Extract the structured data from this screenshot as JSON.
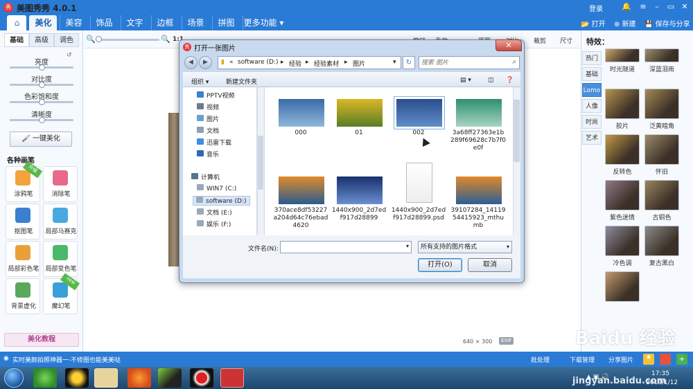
{
  "app": {
    "title": "美图秀秀 4.0.1",
    "logo": "秀",
    "login": "登录"
  },
  "nav": {
    "tabs": [
      "美化",
      "美容",
      "饰品",
      "文字",
      "边框",
      "场景",
      "拼图",
      "更多功能"
    ],
    "active": "美化",
    "actions": {
      "open": "打开",
      "new": "新建",
      "save_share": "保存与分享"
    }
  },
  "left": {
    "subtabs": [
      "基础",
      "高级",
      "调色"
    ],
    "sliders": [
      {
        "label": "亮度",
        "value": 0.5
      },
      {
        "label": "对比度",
        "value": 0.5
      },
      {
        "label": "色彩饱和度",
        "value": 0.5
      },
      {
        "label": "清晰度",
        "value": 0.5
      }
    ],
    "one_click": "一键美化",
    "brushes_heading": "各种画笔",
    "tools": [
      {
        "label": "涂鸦笔",
        "badge": "升级"
      },
      {
        "label": "消除笔",
        "badge": ""
      },
      {
        "label": "抠图笔",
        "badge": ""
      },
      {
        "label": "局部马赛克",
        "badge": ""
      },
      {
        "label": "局部彩色笔",
        "badge": ""
      },
      {
        "label": "局部变色笔",
        "badge": ""
      },
      {
        "label": "背景虚化",
        "badge": ""
      },
      {
        "label": "魔幻笔",
        "badge": "new"
      }
    ],
    "tutorial": "美化教程"
  },
  "toolbar": {
    "zoom_prefix": "1:1",
    "items": [
      "撤销",
      "重做",
      "原图",
      "对比",
      "裁剪",
      "尺寸"
    ]
  },
  "canvas": {
    "size": "640 × 300",
    "exif": "EXIF"
  },
  "right": {
    "title": "特效：",
    "categories": [
      "热门",
      "基础",
      "Lomo",
      "人像",
      "时尚",
      "艺术"
    ],
    "active_category": "Lomo",
    "effects": [
      {
        "label": "时光隧道",
        "color": "#c9a76d"
      },
      {
        "label": "深蓝泪雨",
        "color": "#9c8f6c"
      },
      {
        "label": "胶片",
        "color": "#b89550"
      },
      {
        "label": "泛黄暗角",
        "color": "#a48a55"
      },
      {
        "label": "反转色",
        "color": "#c29a48"
      },
      {
        "label": "怀旧",
        "color": "#9c8a6a"
      },
      {
        "label": "紫色迷情",
        "color": "#8f7a86"
      },
      {
        "label": "古铜色",
        "color": "#9a8461"
      },
      {
        "label": "冷色调",
        "color": "#8f8aa0"
      },
      {
        "label": "复古黑白",
        "color": "#8b8b8b"
      },
      {
        "label": "",
        "color": "#c39a6e"
      }
    ]
  },
  "bottom": {
    "tip": "实时美颜拍照神器一·不修图也能美美哒",
    "links": [
      "批处理",
      "下载管理",
      "分享图片"
    ]
  },
  "taskbar": {
    "time": "17:35",
    "date": "2019/1/12"
  },
  "watermark": {
    "logo": "Baidu 经验",
    "url": "jingyan.baidu.com"
  },
  "dialog": {
    "title": "打开一张图片",
    "close": "✕",
    "breadcrumb": [
      "«",
      "software (D:)",
      "▸",
      "经验",
      "▸",
      "经验素材",
      "▸",
      "图片"
    ],
    "search_placeholder": "搜索 图片",
    "commands": {
      "organize": "组织 ▾",
      "new_folder": "新建文件夹"
    },
    "nav_items": [
      {
        "label": "PPTV视频",
        "color": "#3a80d0"
      },
      {
        "label": "视频",
        "color": "#6a7b8f"
      },
      {
        "label": "图片",
        "color": "#6a9fd0"
      },
      {
        "label": "文档",
        "color": "#8fa0b4"
      },
      {
        "label": "迅雷下载",
        "color": "#3b8fe0"
      },
      {
        "label": "音乐",
        "color": "#2d6ab8"
      },
      {
        "label": "计算机",
        "color": "#5a7391"
      },
      {
        "label": "WIN7 (C:)",
        "color": "#9aa9b9"
      },
      {
        "label": "software (D:)",
        "color": "#9aa9b9"
      },
      {
        "label": "文档 (E:)",
        "color": "#9aa9b9"
      },
      {
        "label": "娱乐 (F:)",
        "color": "#9aa9b9"
      }
    ],
    "selected_nav": "software (D:)",
    "files": [
      {
        "name": "000",
        "colors": [
          "#3a6aa8",
          "#8fb7d9"
        ]
      },
      {
        "name": "01",
        "colors": [
          "#d9b824",
          "#5a7d28"
        ]
      },
      {
        "name": "002",
        "colors": [
          "#2b4c8c",
          "#5f8fc9"
        ]
      },
      {
        "name": "3a68ff27363e1b289f69628c7b7f0e0f",
        "colors": [
          "#2e8f6e",
          "#a8d4c2"
        ]
      },
      {
        "name": "370ace8df53227a204d64c76ebad4620",
        "colors": [
          "#e08a2a",
          "#2a5c8f"
        ]
      },
      {
        "name": "1440x900_2d7edf917d28899",
        "colors": [
          "#18306e",
          "#6a8fd0"
        ]
      },
      {
        "name": "1440x900_2d7edf917d28899.psd",
        "colors": [
          "#ffffff",
          "#eeeeee"
        ]
      },
      {
        "name": "39107284_1411954415923_mthumb",
        "colors": [
          "#e0892a",
          "#2b5f94"
        ]
      }
    ],
    "selected_file": "002",
    "filename_label": "文件名(N):",
    "filename_value": "",
    "filetype": "所有支持的图片格式",
    "open": "打开(O)",
    "cancel": "取消"
  }
}
